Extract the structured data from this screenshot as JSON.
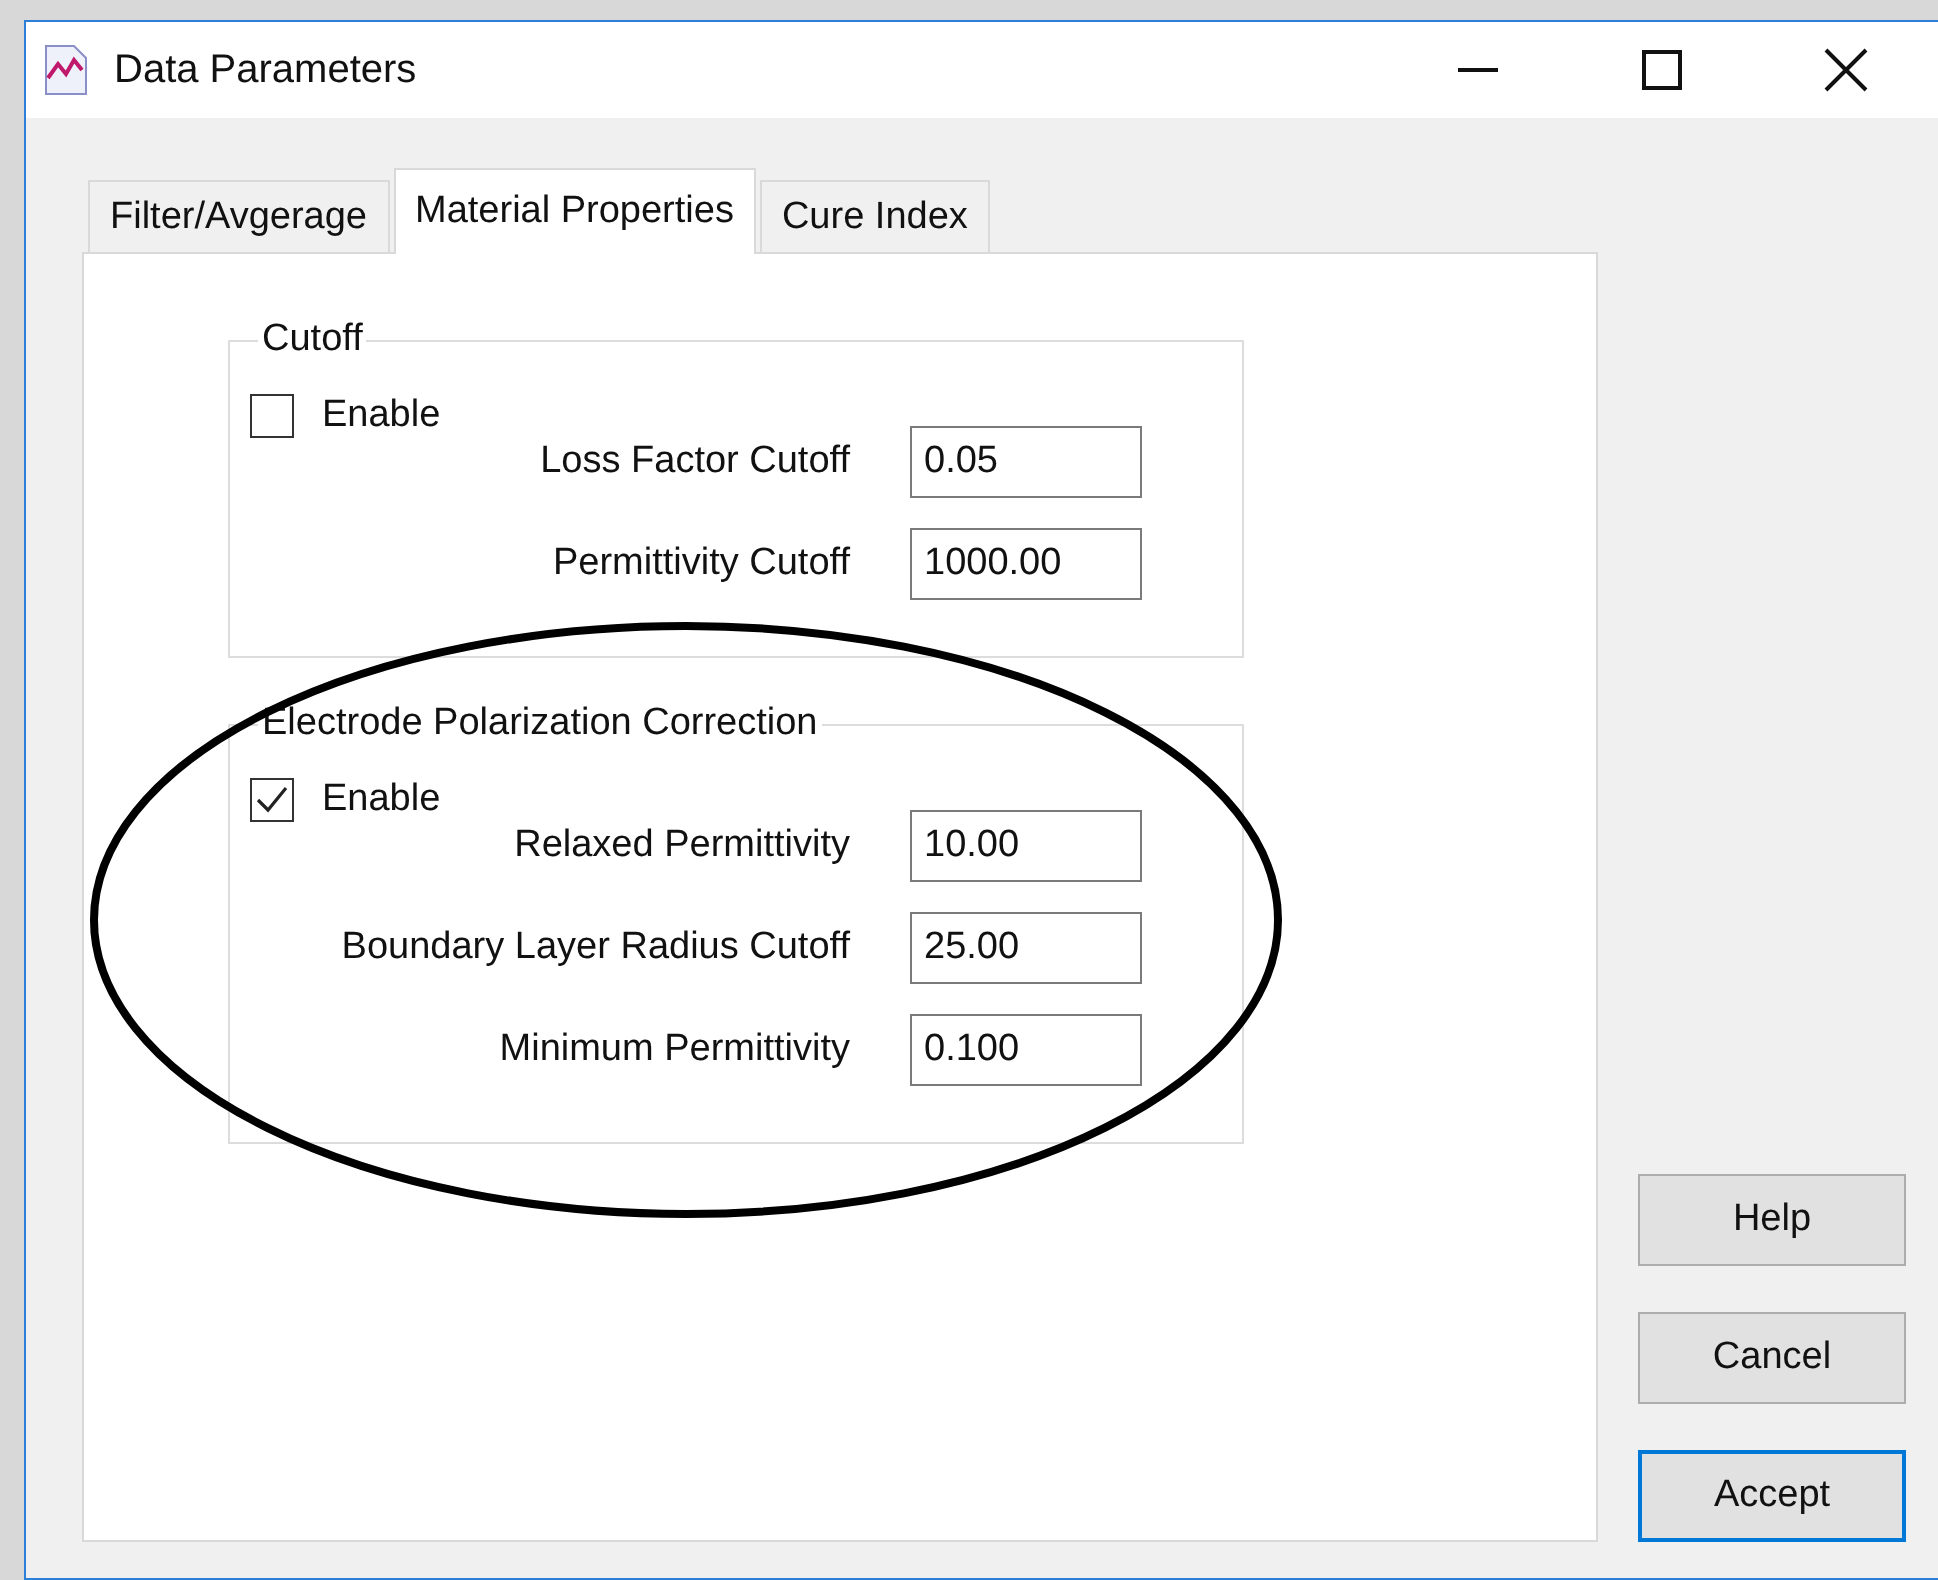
{
  "window": {
    "title": "Data Parameters"
  },
  "tabs": [
    {
      "label": "Filter/Avgerage",
      "selected": false
    },
    {
      "label": "Material Properties",
      "selected": true
    },
    {
      "label": "Cure Index",
      "selected": false
    }
  ],
  "groups": [
    {
      "title": "Cutoff",
      "enable": {
        "label": "Enable",
        "checked": false
      },
      "fields": [
        {
          "label": "Loss Factor Cutoff",
          "value": "0.05"
        },
        {
          "label": "Permittivity Cutoff",
          "value": "1000.00"
        }
      ]
    },
    {
      "title": "Electrode Polarization Correction",
      "enable": {
        "label": "Enable",
        "checked": true
      },
      "fields": [
        {
          "label": "Relaxed Permittivity",
          "value": "10.00"
        },
        {
          "label": "Boundary Layer Radius Cutoff",
          "value": "25.00"
        },
        {
          "label": "Minimum Permittivity",
          "value": "0.100"
        }
      ]
    }
  ],
  "buttons": [
    {
      "label": "Help",
      "default": false
    },
    {
      "label": "Cancel",
      "default": false
    },
    {
      "label": "Accept",
      "default": true
    }
  ]
}
